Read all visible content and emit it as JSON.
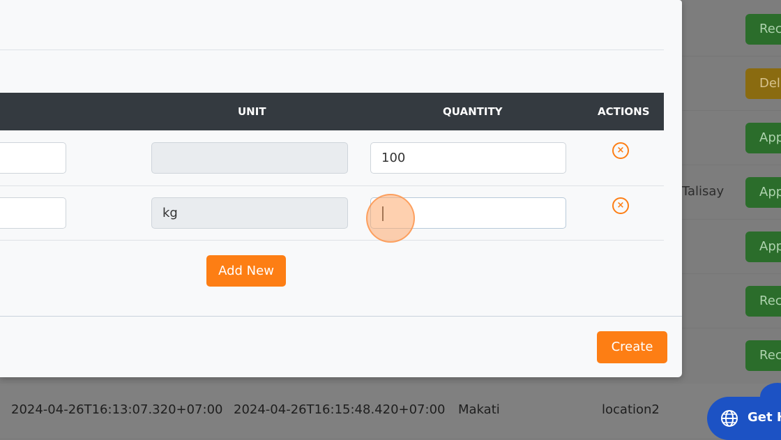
{
  "background": {
    "statuses": [
      {
        "label": "Rec",
        "color": "green"
      },
      {
        "label": "Deli",
        "color": "yellow"
      },
      {
        "label": "App",
        "color": "green"
      },
      {
        "label": "App",
        "color": "green"
      },
      {
        "label": "App",
        "color": "green"
      },
      {
        "label": "Rec",
        "color": "green"
      },
      {
        "label": "Rec",
        "color": "green"
      }
    ],
    "partial_location": "Talisay",
    "bottom_row": {
      "created_at": "2024-04-26T16:13:07.320+07:00",
      "updated_at": "2024-04-26T16:15:48.420+07:00",
      "city": "Makati",
      "location": "location2"
    }
  },
  "modal": {
    "table": {
      "headers": {
        "unit": "UNIT",
        "quantity": "QUANTITY",
        "actions": "ACTIONS"
      },
      "rows": [
        {
          "unit": "",
          "quantity": "100"
        },
        {
          "unit": "kg",
          "quantity": ""
        }
      ]
    },
    "add_new_label": "Add New",
    "create_label": "Create"
  },
  "help": {
    "label": "Get H"
  },
  "colors": {
    "accent": "#fd7e14",
    "header": "#343a40",
    "help": "#1c52c4"
  },
  "icons": {
    "remove": "close-circle-icon",
    "help": "globe-icon"
  }
}
